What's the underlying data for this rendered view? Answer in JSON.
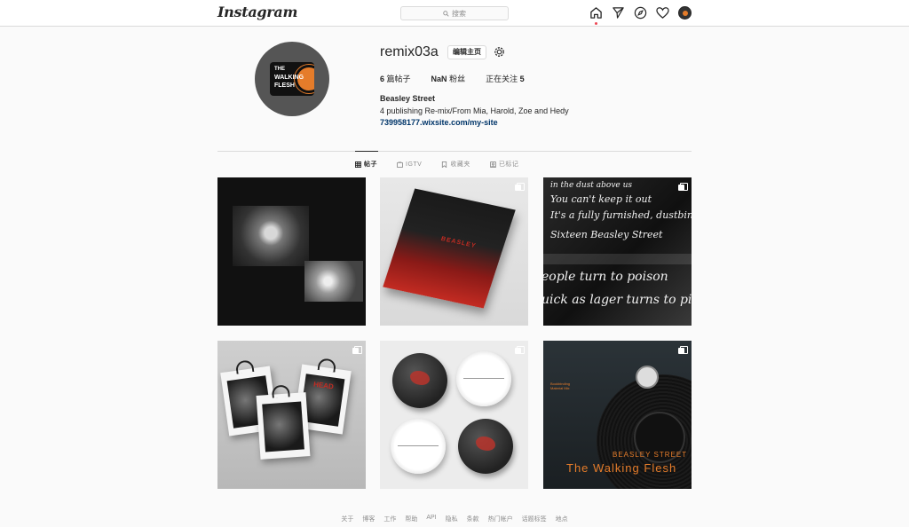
{
  "topbar": {
    "logo": "Instagram",
    "search_placeholder": "搜索",
    "icons": [
      "home-icon",
      "direct-icon",
      "explore-icon",
      "activity-heart-icon",
      "profile-avatar-icon"
    ]
  },
  "profile": {
    "username": "remix03a",
    "edit_label": "编辑主页",
    "avatar_text_line1": "THE",
    "avatar_text_line2": "WALKING",
    "avatar_text_line3": "FLESH",
    "stats": {
      "posts_value": "6",
      "posts_label": "篇帖子",
      "followers_value": "NaN",
      "followers_label": "粉丝",
      "following_label": "正在关注",
      "following_value": "5"
    },
    "bio_name": "Beasley Street",
    "bio_text": "4 publishing Re-mix/From Mia, Harold, Zoe and Hedy",
    "bio_link": "739958177.wixsite.com/my-site"
  },
  "tabs": [
    {
      "label": "帖子",
      "active": true,
      "icon": "grid-icon"
    },
    {
      "label": "IGTV",
      "active": false,
      "icon": "igtv-icon"
    },
    {
      "label": "收藏夹",
      "active": false,
      "icon": "bookmark-icon"
    },
    {
      "label": "已标记",
      "active": false,
      "icon": "tagged-icon"
    }
  ],
  "posts": {
    "p2_text": "BEASLEY",
    "p3_lines": [
      "in the dust above us",
      "You can't keep it out",
      "It's a fully furnished, dustbin",
      "Sixteen Beasley Street",
      "eople turn to poison",
      "uick as lager turns to piss"
    ],
    "p4_text": "HEAD",
    "p6_label1": "BEASLEY STREET",
    "p6_label2": "The Walking Flesh",
    "p6_side": "Bookbinding Material Mix"
  },
  "footer": [
    "关于",
    "博客",
    "工作",
    "帮助",
    "API",
    "隐私",
    "条款",
    "热门帐户",
    "话题标签",
    "地点"
  ],
  "colors": {
    "accent_orange": "#e57c2a",
    "link_blue": "#003569",
    "notification_red": "#ed4956"
  }
}
